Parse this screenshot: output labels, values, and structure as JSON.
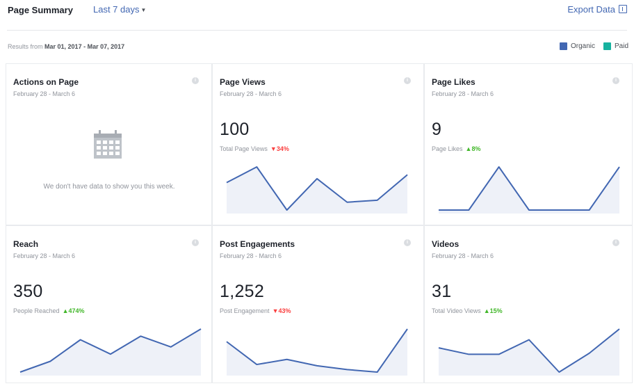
{
  "header": {
    "title": "Page Summary",
    "period_label": "Last 7 days",
    "export_label": "Export Data"
  },
  "results": {
    "prefix": "Results from",
    "range": "Mar 01, 2017 - Mar 07, 2017"
  },
  "legend": {
    "organic_label": "Organic",
    "paid_label": "Paid",
    "organic_color": "#4267b2",
    "paid_color": "#17b29f"
  },
  "cards": [
    {
      "title": "Actions on Page",
      "date": "February 28 - March 6",
      "empty": true,
      "empty_text": "We don't have data to show you this week."
    },
    {
      "title": "Page Views",
      "date": "February 28 - March 6",
      "value": "100",
      "sub_label": "Total Page Views",
      "delta": "34%",
      "delta_dir": "down",
      "spark": [
        14,
        18,
        7,
        15,
        9,
        9.5,
        16
      ]
    },
    {
      "title": "Page Likes",
      "date": "February 28 - March 6",
      "value": "9",
      "sub_label": "Page Likes",
      "delta": "8%",
      "delta_dir": "up",
      "spark": [
        0,
        0,
        3,
        0,
        0,
        0,
        3
      ]
    },
    {
      "title": "Reach",
      "date": "February 28 - March 6",
      "value": "350",
      "sub_label": "People Reached",
      "delta": "474%",
      "delta_dir": "up",
      "spark": [
        30,
        45,
        75,
        55,
        80,
        65,
        90
      ]
    },
    {
      "title": "Post Engagements",
      "date": "February 28 - March 6",
      "value": "1,252",
      "sub_label": "Post Engagement",
      "delta": "43%",
      "delta_dir": "down",
      "spark": [
        210,
        120,
        140,
        115,
        100,
        90,
        260
      ]
    },
    {
      "title": "Videos",
      "date": "February 28 - March 6",
      "value": "31",
      "sub_label": "Total Video Views",
      "delta": "15%",
      "delta_dir": "up",
      "spark": [
        5,
        3.8,
        3.8,
        6.5,
        0.5,
        4,
        8.5
      ]
    }
  ],
  "icons": {
    "info": "info-icon",
    "empty": "calendar-icon",
    "caret": "caret-down-icon",
    "export": "export-icon"
  }
}
